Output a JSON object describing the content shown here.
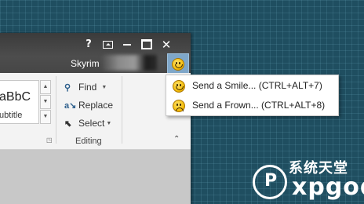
{
  "window": {
    "user_name": "Skyrim",
    "buttons": {
      "help": "?",
      "close": "✕"
    }
  },
  "ribbon": {
    "styles": {
      "preview_main": "aBbC",
      "preview_sub": "ubtitle"
    },
    "editing": {
      "find": "Find",
      "replace": "Replace",
      "select": "Select",
      "group_label": "Editing"
    }
  },
  "smile_menu": {
    "items": [
      {
        "label": "Send a Smile... (CTRL+ALT+7)",
        "icon": "smile-face-icon"
      },
      {
        "label": "Send a Frown... (CTRL+ALT+8)",
        "icon": "frown-face-icon"
      }
    ]
  },
  "watermark": {
    "chinese": "系统天堂",
    "latin": "xpgod"
  },
  "colors": {
    "desktop": "#1f4e60",
    "titlebar": "#3b3b3b",
    "smile_button_highlight": "#7fa7c9",
    "menu_background": "#ffffff"
  }
}
